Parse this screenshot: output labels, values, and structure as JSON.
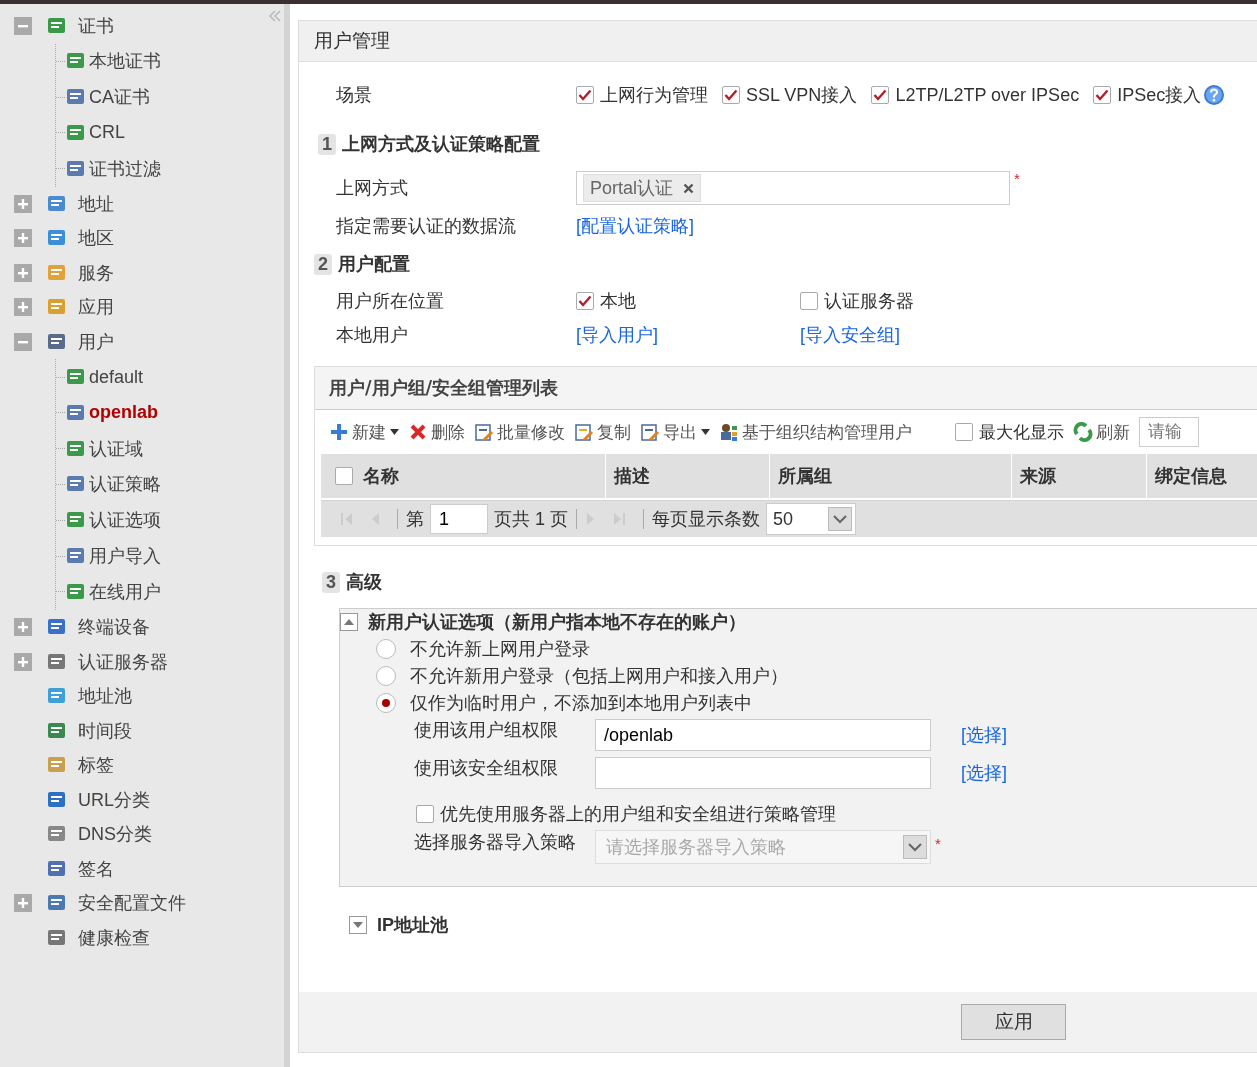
{
  "sidebar": {
    "items": [
      {
        "label": "证书",
        "expanded": true,
        "selected": false,
        "children": [
          {
            "label": "本地证书",
            "selected": false
          },
          {
            "label": "CA证书",
            "selected": false
          },
          {
            "label": "CRL",
            "selected": false
          },
          {
            "label": "证书过滤",
            "selected": false
          }
        ]
      },
      {
        "label": "地址",
        "expanded": false,
        "selected": false
      },
      {
        "label": "地区",
        "expanded": false,
        "selected": false
      },
      {
        "label": "服务",
        "expanded": false,
        "selected": false
      },
      {
        "label": "应用",
        "expanded": false,
        "selected": false
      },
      {
        "label": "用户",
        "expanded": true,
        "selected": false,
        "children": [
          {
            "label": "default",
            "selected": false
          },
          {
            "label": "openlab",
            "selected": true
          },
          {
            "label": "认证域",
            "selected": false
          },
          {
            "label": "认证策略",
            "selected": false
          },
          {
            "label": "认证选项",
            "selected": false
          },
          {
            "label": "用户导入",
            "selected": false
          },
          {
            "label": "在线用户",
            "selected": false
          }
        ]
      },
      {
        "label": "终端设备",
        "expanded": false,
        "selected": false
      },
      {
        "label": "认证服务器",
        "expanded": false,
        "selected": false
      },
      {
        "label": "地址池",
        "selected": false
      },
      {
        "label": "时间段",
        "selected": false
      },
      {
        "label": "标签",
        "selected": false
      },
      {
        "label": "URL分类",
        "selected": false
      },
      {
        "label": "DNS分类",
        "selected": false
      },
      {
        "label": "签名",
        "selected": false
      },
      {
        "label": "安全配置文件",
        "expanded": false,
        "selected": false
      },
      {
        "label": "健康检查",
        "selected": false
      }
    ]
  },
  "panel": {
    "title": "用户管理",
    "scenario": {
      "label": "场景",
      "options": [
        {
          "label": "上网行为管理",
          "checked": true
        },
        {
          "label": "SSL VPN接入",
          "checked": true
        },
        {
          "label": "L2TP/L2TP over IPSec",
          "checked": true
        },
        {
          "label": "IPSec接入",
          "checked": true
        }
      ]
    },
    "section_1": {
      "number": "1",
      "title": "上网方式及认证策略配置",
      "access_method": {
        "label": "上网方式",
        "tags": [
          "Portal认证"
        ],
        "required_mark": "*"
      },
      "auth_flow": {
        "label": "指定需要认证的数据流",
        "link": "[配置认证策略]"
      }
    },
    "section_2": {
      "number": "2",
      "title": "用户配置",
      "location": {
        "label": "用户所在位置",
        "options": [
          {
            "label": "本地",
            "checked": true
          },
          {
            "label": "认证服务器",
            "checked": false
          }
        ]
      },
      "local_users": {
        "label": "本地用户",
        "links": [
          "[导入用户]",
          "[导入安全组]"
        ]
      }
    },
    "user_list": {
      "title": "用户/用户组/安全组管理列表",
      "toolbar": [
        {
          "label": "新建",
          "dropdown": true
        },
        {
          "label": "删除",
          "dropdown": false
        },
        {
          "label": "批量修改",
          "dropdown": false
        },
        {
          "label": "复制",
          "dropdown": false
        },
        {
          "label": "导出",
          "dropdown": true
        },
        {
          "label": "基于组织结构管理用户",
          "dropdown": false
        }
      ],
      "maximize": {
        "label": "最大化显示",
        "checked": false
      },
      "refresh": "刷新",
      "search_placeholder": "请输",
      "select_all": {
        "checked": false
      },
      "columns": [
        "名称",
        "描述",
        "所属组",
        "来源",
        "绑定信息"
      ],
      "pager": {
        "page_prefix": "第",
        "page": "1",
        "page_suffix": "页共 1 页",
        "per_page_label": "每页显示条数",
        "per_page": "50"
      }
    },
    "section_3": {
      "number": "3",
      "title": "高级",
      "new_user": {
        "title": "新用户认证选项（新用户指本地不存在的账户）",
        "expanded": true,
        "options": [
          {
            "label": "不允许新上网用户登录",
            "selected": false
          },
          {
            "label": "不允许新用户登录（包括上网用户和接入用户）",
            "selected": false
          },
          {
            "label": "仅作为临时用户，不添加到本地用户列表中",
            "selected": true
          }
        ],
        "user_group": {
          "label": "使用该用户组权限",
          "value": "/openlab",
          "link": "[选择]"
        },
        "security_group": {
          "label": "使用该安全组权限",
          "link": "[选择]"
        },
        "prefer_server": {
          "label": "优先使用服务器上的用户组和安全组进行策略管理",
          "checked": false
        },
        "import_policy": {
          "label": "选择服务器导入策略",
          "placeholder": "请选择服务器导入策略",
          "required_mark": "*",
          "disabled": true
        }
      },
      "ip_pool": {
        "title": "IP地址池",
        "expanded": false
      }
    },
    "apply_button": "应用"
  }
}
